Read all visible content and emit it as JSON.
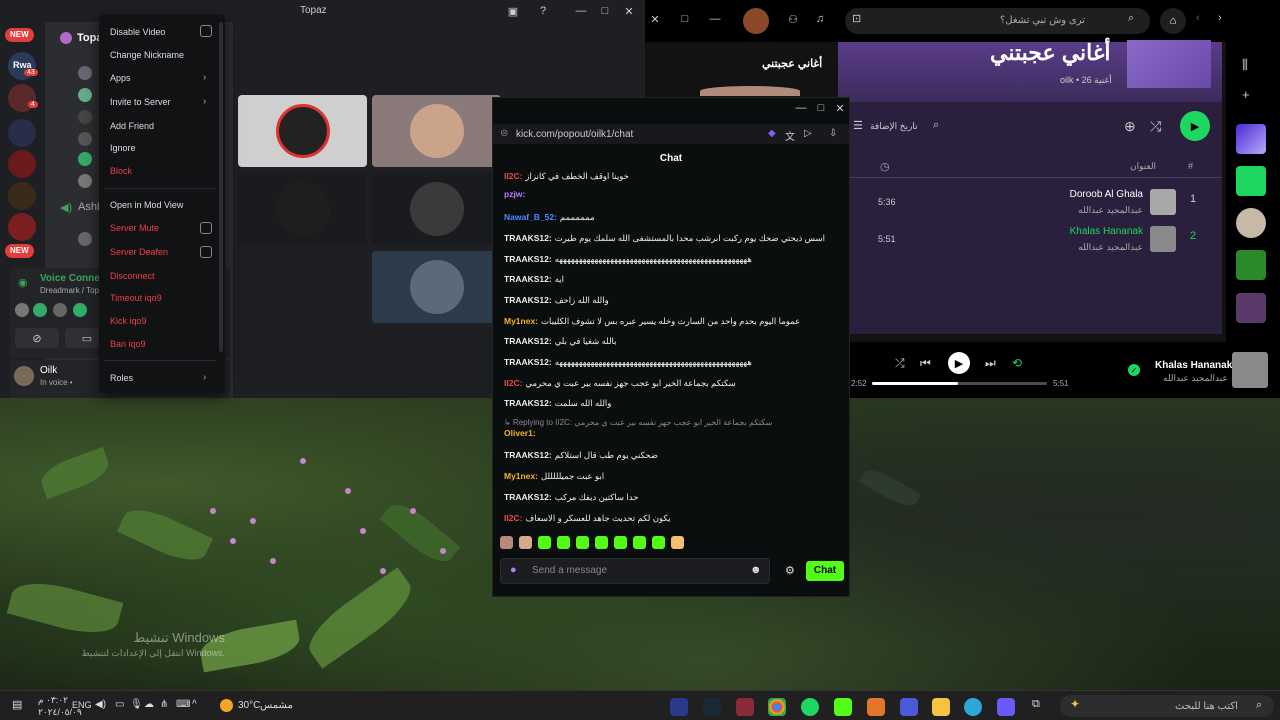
{
  "discord": {
    "title": "Topaz",
    "server_short": "Topa",
    "ashb": "Ashb",
    "voice_title": "Voice Connected",
    "voice_sub": "Dreadmark / Topa",
    "user_name": "Oilk",
    "user_status": "In voice •",
    "new_badge": "NEW",
    "badge_43": "43",
    "badge_4": "4",
    "rwa": "Rwa"
  },
  "context_menu": {
    "items": [
      {
        "label": "Disable Video"
      },
      {
        "label": "Change Nickname"
      },
      {
        "label": "Apps"
      },
      {
        "label": "Invite to Server"
      },
      {
        "label": "Add Friend"
      },
      {
        "label": "Ignore"
      },
      {
        "label": "Block"
      },
      {
        "label": "Open in Mod View"
      },
      {
        "label": "Server Mute"
      },
      {
        "label": "Server Deafen"
      },
      {
        "label": "Disconnect"
      },
      {
        "label": "Timeout iqo9"
      },
      {
        "label": "Kick iqo9"
      },
      {
        "label": "Ban iqo9"
      },
      {
        "label": "Roles"
      }
    ]
  },
  "kick": {
    "url": "kick.com/popout/oilk1/chat",
    "chat_header": "Chat",
    "messages": [
      {
        "user": "II2C:",
        "text": "خوينا اوقف الخطف في كانزاز",
        "color": "#e94a4a"
      },
      {
        "user": "pzjw:",
        "text": "",
        "color": "#b57cff"
      },
      {
        "user": "Nawaf_B_52:",
        "text": "ممممممم",
        "color": "#4a8cff"
      },
      {
        "user": "TRAAKS12:",
        "text": "اسس ذيحتي ضحك يوم ركبت ابرشب محدا بالمستشفى الله سلمك يوم طيرت",
        "color": "#eee"
      },
      {
        "user": "TRAAKS12:",
        "text": "هههههههههههههههههههههههههههههههههههههههههههههههههه",
        "color": "#eee"
      },
      {
        "user": "TRAAKS12:",
        "text": "ايه",
        "color": "#eee"
      },
      {
        "user": "TRAAKS12:",
        "text": "والله الله زاحف",
        "color": "#eee"
      },
      {
        "user": "My1nex:",
        "text": "عموما اليوم بحدم واحد من السارث وخله يسير عبره بس لا تشوف الكليبات",
        "color": "#f0b429"
      },
      {
        "user": "TRAAKS12:",
        "text": "بالله شغيا في بلي",
        "color": "#eee"
      },
      {
        "user": "TRAAKS12:",
        "text": "هههههههههههههههههههههههههههههههههههههههههههههههههه",
        "color": "#eee"
      },
      {
        "user": "II2C:",
        "text": "سكتكم بجماعة الخير ابو عجب جهز نفسه بير عبت ي محرمي",
        "color": "#e94a4a"
      },
      {
        "user": "TRAAKS12:",
        "text": "والله الله سلمت",
        "color": "#eee"
      },
      {
        "user": "Oliver1:",
        "text": "",
        "color": "#f0b429"
      },
      {
        "user": "TRAAKS12:",
        "text": "ضحكني يوم طب قال استلاكم",
        "color": "#eee"
      },
      {
        "user": "My1nex:",
        "text": "ابو عبت جميلللللل",
        "color": "#f0b429"
      },
      {
        "user": "TRAAKS12:",
        "text": "حدا ساكتين ديفك مركب",
        "color": "#eee"
      },
      {
        "user": "II2C:",
        "text": "يكون لكم تحديث جاهد للعسكر و الاسعاف",
        "color": "#e94a4a"
      }
    ],
    "reply_hint": "↳ Replying to II2C: سكتكم بجماعة الخير ابو عجب جهز نفسه بير عبت ي محرمي",
    "send_placeholder": "Send a message",
    "chat_button": "Chat"
  },
  "spotify": {
    "search_placeholder": "ترى وش تبي تشغل؟",
    "left_title": "أغاني عجبتني",
    "playlist_title": "أغاني عجبتني",
    "playlist_meta": "oilk • 26 أغنية",
    "sort_label": "تاريخ الإضافة",
    "col_title": "العنوان",
    "col_num": "#",
    "tracks": [
      {
        "num": "1",
        "title": "Doroob Al Ghala",
        "artist": "عبدالمجيد عبدالله",
        "duration": "5:36",
        "active": false
      },
      {
        "num": "2",
        "title": "Khalas Hananak",
        "artist": "عبدالمجيد عبدالله",
        "duration": "5:51",
        "active": true
      }
    ],
    "now_playing": {
      "title": "Khalas Hananak",
      "artist": "عبدالمجيد عبدالله",
      "current": "2:52",
      "total": "5:51",
      "progress": 0.49
    }
  },
  "taskbar": {
    "search_placeholder": "اكتب هنا للبحث",
    "weather_temp": "30°C",
    "weather_label": "مشمس",
    "clock_time": "٠٣:٠٢ م",
    "clock_date": "٢٠٢٤/٠٥/٠٩",
    "lang": "ENG"
  },
  "watermark": {
    "line1": "تنشيط Windows",
    "line2": "انتقل إلى الإعدادات لتنشيط Windows."
  },
  "colors": {
    "kick_green": "#53fc18",
    "spotify_green": "#1ed760",
    "discord_red": "#f23f43"
  }
}
